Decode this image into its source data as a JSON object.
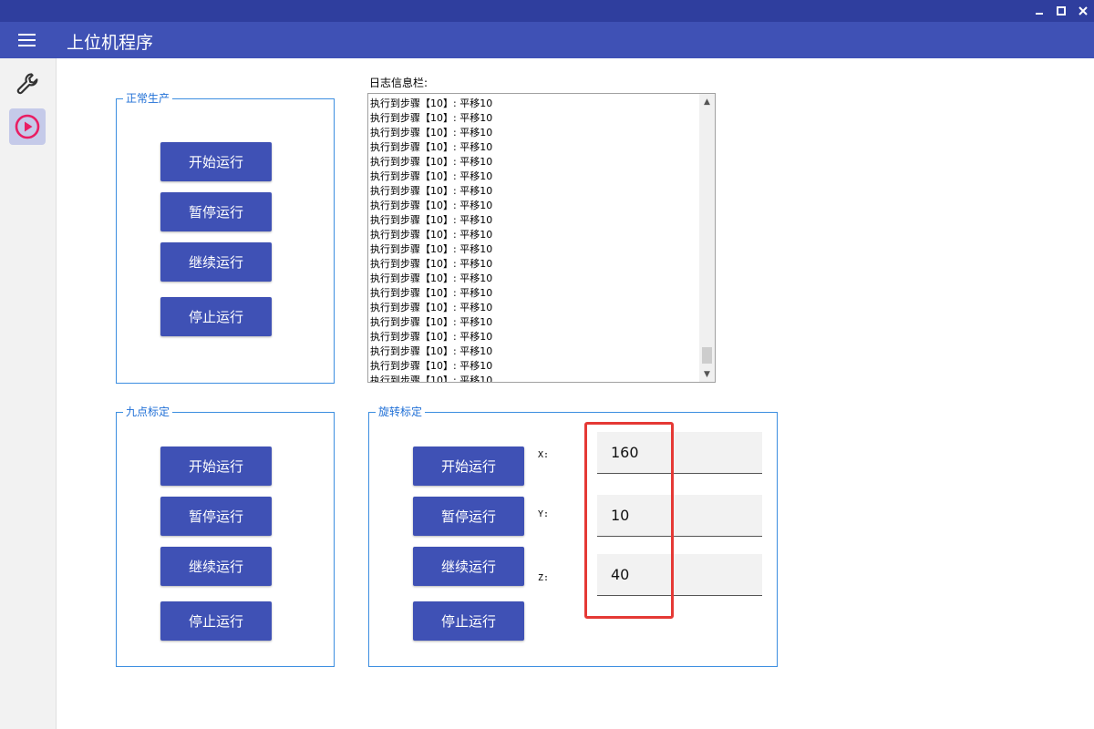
{
  "window": {
    "minimize_glyph": "▬",
    "maximize_glyph": "☐",
    "close_glyph": "✕"
  },
  "header": {
    "title": "上位机程序",
    "menu_icon": "hamburger-icon"
  },
  "sidebar": {
    "items": [
      {
        "icon": "wrench-icon",
        "active": false
      },
      {
        "icon": "play-circle-icon",
        "active": true,
        "color": "#e91e63"
      }
    ]
  },
  "normal_production": {
    "legend": "正常生产",
    "buttons": [
      "开始运行",
      "暂停运行",
      "继续运行",
      "停止运行"
    ]
  },
  "nine_point": {
    "legend": "九点标定",
    "buttons": [
      "开始运行",
      "暂停运行",
      "继续运行",
      "停止运行"
    ]
  },
  "rotation": {
    "legend": "旋转标定",
    "buttons": [
      "开始运行",
      "暂停运行",
      "继续运行",
      "停止运行"
    ],
    "x_label": "X:",
    "y_label": "Y:",
    "z_label": "Z:",
    "x_value": "160",
    "y_value": "10",
    "z_value": "40"
  },
  "log": {
    "label": "日志信息栏:",
    "line_text": "执行到步骤【10】: 平移10",
    "visible_lines": 20
  },
  "colors": {
    "accent": "#3f51b5",
    "titlebar": "#2f3e9e",
    "highlight": "#e53935"
  }
}
